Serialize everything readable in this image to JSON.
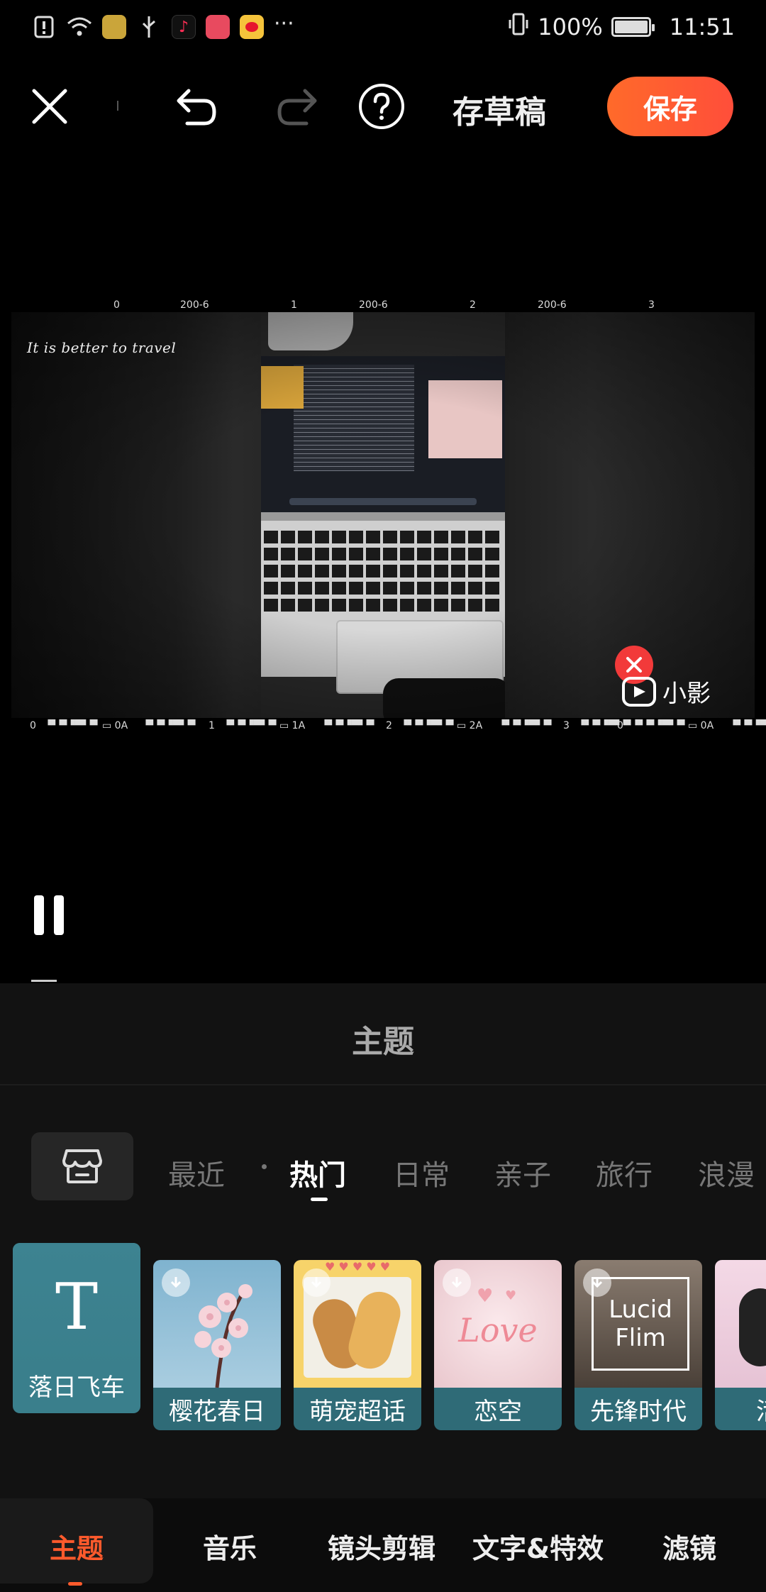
{
  "status_bar": {
    "battery_text": "100%",
    "battery_level": 1.0,
    "time": "11:51",
    "overflow": "···"
  },
  "toolbar": {
    "draft_label": "存草稿",
    "save_label": "保存"
  },
  "preview": {
    "film_top": [
      "0",
      "200-6",
      "1",
      "200-6",
      "2",
      "200-6",
      "3"
    ],
    "film_bottom": [
      "0",
      "▝▘▀▝▀▘▀",
      "▭ 0A",
      "▝▘▀▝▀▘▀",
      "1",
      "▝▘▀▝▀▘▀",
      "▭ 1A",
      "▝▘▀▝▀▘▀",
      "2",
      "▝▘▀▝▀▘▀",
      "▭ 2A",
      "▝▘▀▝▀▘▀",
      "3",
      "▝▘▀▝▀▘▀",
      "0",
      "▝▘▀▝▀▘▀",
      "▭ 0A",
      "▝▘▀▝▀▘▀"
    ],
    "script_text": "It is better to travel",
    "watermark_text": "小影"
  },
  "panel": {
    "title": "主题",
    "categories": [
      "最近",
      "热门",
      "日常",
      "亲子",
      "旅行",
      "浪漫"
    ],
    "active_category": "热门",
    "themes": [
      {
        "label": "落日飞车",
        "glyph": "T",
        "selected": true
      },
      {
        "label": "樱花春日"
      },
      {
        "label": "萌宠超话"
      },
      {
        "label": "恋空",
        "overlay_text": "Love"
      },
      {
        "label": "先锋时代",
        "overlay_text_1": "Lucid",
        "overlay_text_2": "Flim"
      },
      {
        "label": "活力"
      }
    ]
  },
  "bottom_nav": {
    "items": [
      "主题",
      "音乐",
      "镜头剪辑",
      "文字&特效",
      "滤镜"
    ],
    "active": "主题"
  },
  "colors": {
    "accent": "#ff5a2c",
    "save_gradient_start": "#ff6a2a",
    "theme_label_bg": "#2f6b77",
    "watermark_close": "#f23a3a"
  }
}
